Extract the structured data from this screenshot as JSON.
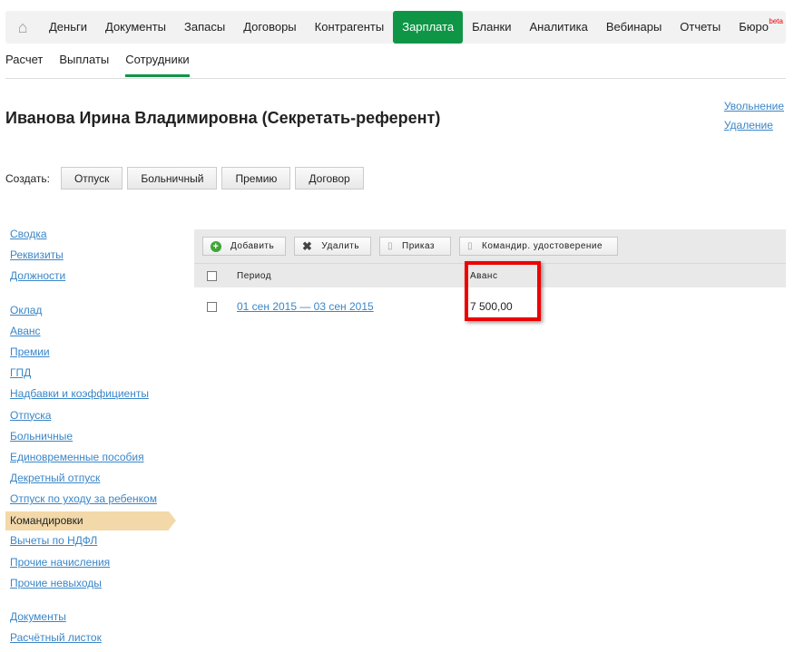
{
  "topnav": {
    "items": [
      "Деньги",
      "Документы",
      "Запасы",
      "Договоры",
      "Контрагенты",
      "Зарплата",
      "Бланки",
      "Аналитика",
      "Вебинары",
      "Отчеты",
      "Бюро"
    ],
    "active": "Зарплата",
    "beta": "beta"
  },
  "subnav": {
    "items": [
      "Расчет",
      "Выплаты",
      "Сотрудники"
    ],
    "active": "Сотрудники"
  },
  "title": "Иванова Ирина Владимировна (Секретать-референт)",
  "actions": {
    "dismiss": "Увольнение",
    "delete": "Удаление"
  },
  "create": {
    "label": "Создать:",
    "buttons": [
      "Отпуск",
      "Больничный",
      "Премию",
      "Договор"
    ]
  },
  "sidebar": {
    "groups": [
      [
        "Сводка",
        "Реквизиты",
        "Должности"
      ],
      [
        "Оклад",
        "Аванс",
        "Премии",
        "ГПД",
        "Надбавки и коэффициенты",
        "Отпуска",
        "Больничные",
        "Единовременные пособия",
        "Декретный отпуск",
        "Отпуск по уходу за ребенком",
        "Командировки",
        "Вычеты по НДФЛ",
        "Прочие начисления",
        "Прочие невыходы"
      ],
      [
        "Документы",
        "Расчётный листок"
      ]
    ],
    "selected": "Командировки"
  },
  "toolbar": {
    "add": "Добавить",
    "delete": "Удалить",
    "order": "Приказ",
    "certificate": "Командир. удостоверение"
  },
  "table": {
    "headers": [
      "Период",
      "Аванс"
    ],
    "rows": [
      {
        "period": "01 сен 2015 — 03 сен 2015",
        "advance": "7 500,00"
      }
    ]
  }
}
